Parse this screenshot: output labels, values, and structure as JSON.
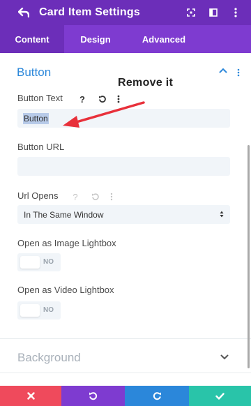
{
  "header": {
    "title": "Card Item Settings",
    "background": "#6c2eb9"
  },
  "tabs": [
    {
      "label": "Content",
      "active": true
    },
    {
      "label": "Design",
      "active": false
    },
    {
      "label": "Advanced",
      "active": false
    }
  ],
  "section": {
    "title": "Button",
    "expanded": true,
    "accent": "#2b87da"
  },
  "annotation": {
    "text": "Remove it",
    "arrow_color": "#e8303a"
  },
  "fields": {
    "button_text": {
      "label": "Button Text",
      "value": "Button",
      "help_icon": "?"
    },
    "button_url": {
      "label": "Button URL",
      "value": ""
    },
    "url_opens": {
      "label": "Url Opens",
      "value": "In The Same Window",
      "help_icon": "?"
    },
    "image_lightbox": {
      "label": "Open as Image Lightbox",
      "toggle": "NO"
    },
    "video_lightbox": {
      "label": "Open as Video Lightbox",
      "toggle": "NO"
    }
  },
  "collapsed_section": {
    "title": "Background"
  },
  "footer": {
    "cancel_color": "#ef4a5c",
    "undo_color": "#7e3bd0",
    "redo_color": "#2b87da",
    "save_color": "#29c4a9"
  },
  "icons": {
    "back": "back-arrow-icon",
    "focus": "focus-icon",
    "sidebar": "sidebar-icon",
    "more": "more-vertical-icon",
    "reset": "reset-icon",
    "chevron_up": "chevron-up-icon",
    "chevron_down": "chevron-down-icon",
    "close": "close-icon",
    "undo": "undo-icon",
    "redo": "redo-icon",
    "check": "check-icon"
  }
}
